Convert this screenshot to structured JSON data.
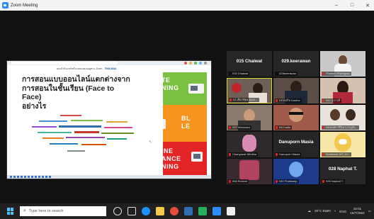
{
  "window": {
    "title": "Zoom Meeting",
    "minimize": "–",
    "maximize": "□",
    "close": "✕"
  },
  "share": {
    "notice_text": "คุณกำลังแชร์หน้าจอของคุณอยู่ทาง Zoom",
    "notice_id": "7548 8444",
    "slide_title": "การสอนแบบออนไลน์แตกต่างจาก\nการสอนในชั้นเรียน (Face to Face)\nอย่างไร",
    "panel_green": "TE\nNING",
    "panel_orange": "BL\nLE",
    "panel_red": "INE\nANCE\nNING"
  },
  "gallery": {
    "tiles": [
      {
        "big": "015 Chaiwat",
        "name": "015 Chaiwat"
      },
      {
        "big": "029.keerawan",
        "name": "029keerawan"
      },
      {
        "big": "",
        "name": "Phaison Phiengrak"
      },
      {
        "big": "",
        "name": "01 เจียวชัยจ.คุณป..."
      },
      {
        "big": "",
        "name": "บรรจงกิจ Kanthe"
      },
      {
        "big": "",
        "name": "042 สุภาวดี"
      },
      {
        "big": "",
        "name": "037 Weeraset"
      },
      {
        "big": "",
        "name": "042 suthi"
      },
      {
        "big": "",
        "name": "045เกศกาสิรีณาภาณุรัก..."
      },
      {
        "big": "",
        "name": "Chanyanat Nithitha"
      },
      {
        "big": "Danuporn Masia",
        "name": "Danuporn Masia"
      },
      {
        "big": "",
        "name": "Somboon 007_Ki..."
      },
      {
        "big": "",
        "name": "068 Ronnat"
      },
      {
        "big": "",
        "name": "040 Phakkarip"
      },
      {
        "big": "028 Naphat T.",
        "name": "028 Naphat T."
      }
    ]
  },
  "taskbar": {
    "search_placeholder": "Type here to search",
    "weather": "29°C ฝนตก",
    "lang": "ENG",
    "time": "15:01",
    "date": "16/7/2564"
  }
}
